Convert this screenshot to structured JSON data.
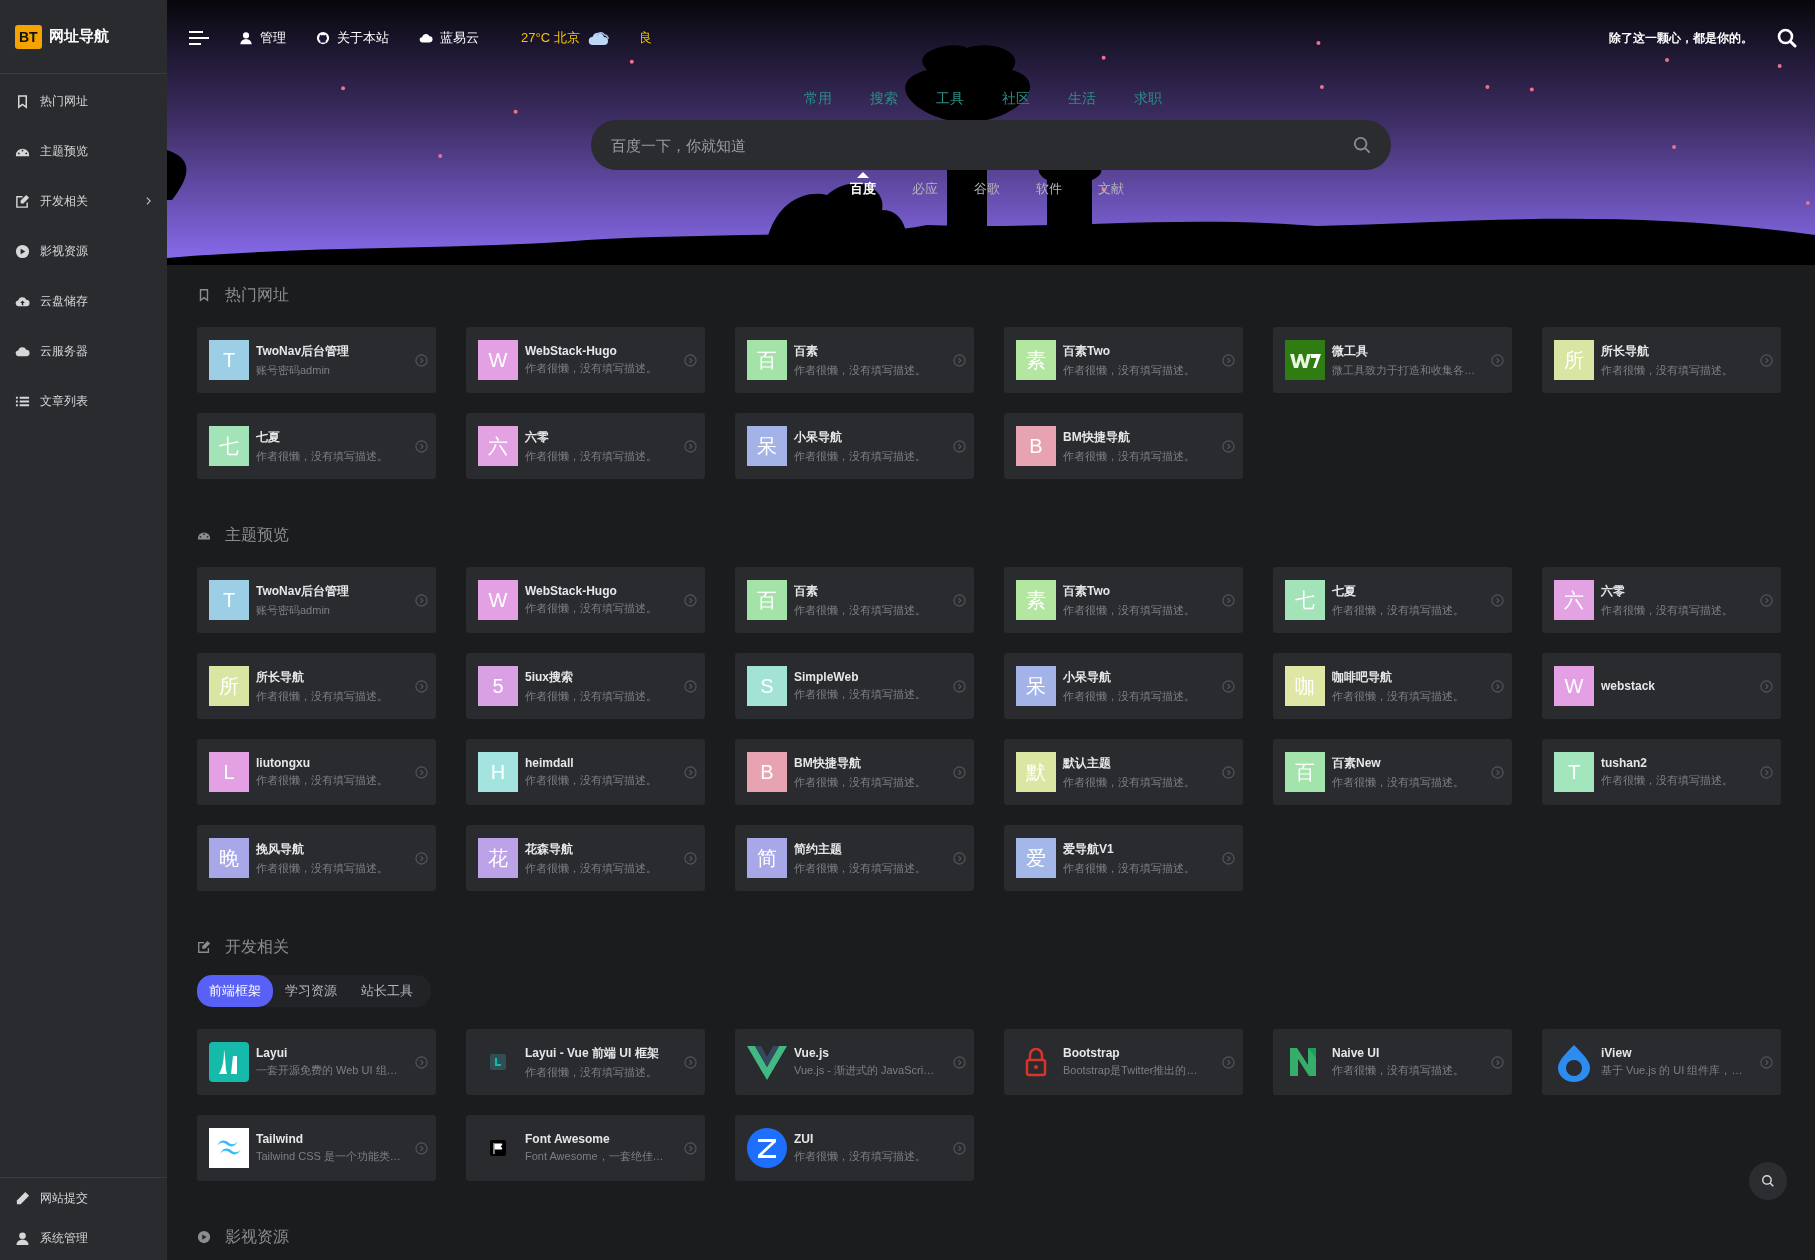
{
  "sidebar": {
    "logo_badge": "BT",
    "logo_text": "网址导航",
    "items": [
      {
        "label": "热门网址",
        "kind": "bookmark",
        "expandable": false
      },
      {
        "label": "主题预览",
        "kind": "gauge",
        "expandable": false
      },
      {
        "label": "开发相关",
        "kind": "edit",
        "expandable": true
      },
      {
        "label": "影视资源",
        "kind": "play",
        "expandable": false
      },
      {
        "label": "云盘储存",
        "kind": "upload",
        "expandable": false
      },
      {
        "label": "云服务器",
        "kind": "cloud",
        "expandable": false
      },
      {
        "label": "文章列表",
        "kind": "list",
        "expandable": false
      }
    ],
    "footer_items": [
      {
        "label": "网站提交",
        "kind": "pencil"
      },
      {
        "label": "系统管理",
        "kind": "user"
      }
    ]
  },
  "topbar": {
    "links": [
      {
        "label": "管理",
        "kind": "user"
      },
      {
        "label": "关于本站",
        "kind": "github"
      },
      {
        "label": "蓝易云",
        "kind": "cloud"
      }
    ],
    "weather": "27°C 北京",
    "air_quality": "良",
    "slogan": "除了这一颗心，都是你的。"
  },
  "search": {
    "groups": [
      "常用",
      "搜索",
      "工具",
      "社区",
      "生活",
      "求职"
    ],
    "placeholder": "百度一下，你就知道",
    "engines": [
      {
        "label": "百度",
        "selected": true
      },
      {
        "label": "必应",
        "selected": false
      },
      {
        "label": "谷歌",
        "selected": false
      },
      {
        "label": "软件",
        "selected": false
      },
      {
        "label": "文献",
        "selected": false
      }
    ]
  },
  "sections": [
    {
      "title": "热门网址",
      "kind": "bookmark",
      "cards": [
        {
          "title": "TwoNav后台管理",
          "desc": "账号密码admin",
          "kind": "letter",
          "letter": "T",
          "color": "#9ccfe6"
        },
        {
          "title": "WebStack-Hugo",
          "desc": "作者很懒，没有填写描述。",
          "kind": "letter",
          "letter": "W",
          "color": "#e3a0e3"
        },
        {
          "title": "百素",
          "desc": "作者很懒，没有填写描述。",
          "kind": "letter",
          "letter": "百",
          "color": "#a3e3a8"
        },
        {
          "title": "百素Two",
          "desc": "作者很懒，没有填写描述。",
          "kind": "letter",
          "letter": "素",
          "color": "#b3e6a0"
        },
        {
          "title": "微工具",
          "desc": "微工具致力于打造和收集各…",
          "kind": "w-logo"
        },
        {
          "title": "所长导航",
          "desc": "作者很懒，没有填写描述。",
          "kind": "letter",
          "letter": "所",
          "color": "#d9e6a3"
        },
        {
          "title": "七夏",
          "desc": "作者很懒，没有填写描述。",
          "kind": "letter",
          "letter": "七",
          "color": "#a3e3b8"
        },
        {
          "title": "六零",
          "desc": "作者很懒，没有填写描述。",
          "kind": "letter",
          "letter": "六",
          "color": "#e3a3e3"
        },
        {
          "title": "小呆导航",
          "desc": "作者很懒，没有填写描述。",
          "kind": "letter",
          "letter": "呆",
          "color": "#a3b3e8"
        },
        {
          "title": "BM快捷导航",
          "desc": "作者很懒，没有填写描述。",
          "kind": "letter",
          "letter": "B",
          "color": "#e8a3b3"
        }
      ]
    },
    {
      "title": "主题预览",
      "kind": "gauge",
      "cards": [
        {
          "title": "TwoNav后台管理",
          "desc": "账号密码admin",
          "kind": "letter",
          "letter": "T",
          "color": "#9ccfe6"
        },
        {
          "title": "WebStack-Hugo",
          "desc": "作者很懒，没有填写描述。",
          "kind": "letter",
          "letter": "W",
          "color": "#e3a0e3"
        },
        {
          "title": "百素",
          "desc": "作者很懒，没有填写描述。",
          "kind": "letter",
          "letter": "百",
          "color": "#a3e3a8"
        },
        {
          "title": "百素Two",
          "desc": "作者很懒，没有填写描述。",
          "kind": "letter",
          "letter": "素",
          "color": "#b3e6a0"
        },
        {
          "title": "七夏",
          "desc": "作者很懒，没有填写描述。",
          "kind": "letter",
          "letter": "七",
          "color": "#a3e3b8"
        },
        {
          "title": "六零",
          "desc": "作者很懒，没有填写描述。",
          "kind": "letter",
          "letter": "六",
          "color": "#e3a3e3"
        },
        {
          "title": "所长导航",
          "desc": "作者很懒，没有填写描述。",
          "kind": "letter",
          "letter": "所",
          "color": "#d9e6a3"
        },
        {
          "title": "5iux搜索",
          "desc": "作者很懒，没有填写描述。",
          "kind": "letter",
          "letter": "5",
          "color": "#d9a0e3"
        },
        {
          "title": "SimpleWeb",
          "desc": "作者很懒，没有填写描述。",
          "kind": "letter",
          "letter": "S",
          "color": "#a3e3d6"
        },
        {
          "title": "小呆导航",
          "desc": "作者很懒，没有填写描述。",
          "kind": "letter",
          "letter": "呆",
          "color": "#a3b3e8"
        },
        {
          "title": "咖啡吧导航",
          "desc": "作者很懒，没有填写描述。",
          "kind": "letter",
          "letter": "咖",
          "color": "#e0e6a3"
        },
        {
          "title": "webstack",
          "kind": "letter",
          "letter": "W",
          "color": "#e3a0e3"
        },
        {
          "title": "liutongxu",
          "desc": "作者很懒，没有填写描述。",
          "kind": "letter",
          "letter": "L",
          "color": "#e3a0e3"
        },
        {
          "title": "heimdall",
          "desc": "作者很懒，没有填写描述。",
          "kind": "letter",
          "letter": "H",
          "color": "#a3e3e0"
        },
        {
          "title": "BM快捷导航",
          "desc": "作者很懒，没有填写描述。",
          "kind": "letter",
          "letter": "B",
          "color": "#e8a3b3"
        },
        {
          "title": "默认主题",
          "desc": "作者很懒，没有填写描述。",
          "kind": "letter",
          "letter": "默",
          "color": "#dbe6a3"
        },
        {
          "title": "百素New",
          "desc": "作者很懒，没有填写描述。",
          "kind": "letter",
          "letter": "百",
          "color": "#a3e3ac"
        },
        {
          "title": "tushan2",
          "desc": "作者很懒，没有填写描述。",
          "kind": "letter",
          "letter": "T",
          "color": "#a3e6bd"
        },
        {
          "title": "挽风导航",
          "desc": "作者很懒，没有填写描述。",
          "kind": "letter",
          "letter": "晚",
          "color": "#a8a8e8"
        },
        {
          "title": "花森导航",
          "desc": "作者很懒，没有填写描述。",
          "kind": "letter",
          "letter": "花",
          "color": "#bca3e8"
        },
        {
          "title": "简约主题",
          "desc": "作者很懒，没有填写描述。",
          "kind": "letter",
          "letter": "简",
          "color": "#a8a8e8"
        },
        {
          "title": "爱导航V1",
          "desc": "作者很懒，没有填写描述。",
          "kind": "letter",
          "letter": "爱",
          "color": "#a3b8e8"
        }
      ]
    },
    {
      "title": "开发相关",
      "kind": "edit",
      "tabs": [
        {
          "label": "前端框架",
          "selected": true
        },
        {
          "label": "学习资源",
          "selected": false
        },
        {
          "label": "站长工具",
          "selected": false
        }
      ],
      "cards": [
        {
          "title": "Layui",
          "desc": "一套开源免费的 Web UI 组…",
          "kind": "l-logo"
        },
        {
          "title": "Layui - Vue 前端 UI 框架",
          "desc": "作者很懒，没有填写描述。",
          "kind": "square-logo"
        },
        {
          "title": "Vue.js",
          "desc": "Vue.js - 渐进式的 JavaScri…",
          "kind": "v-logo"
        },
        {
          "title": "Bootstrap",
          "desc": "Bootstrap是Twitter推出的…",
          "kind": "lock-logo"
        },
        {
          "title": "Naive UI",
          "desc": "作者很懒，没有填写描述。",
          "kind": "n-logo"
        },
        {
          "title": "iView",
          "desc": "基于 Vue.js 的 UI 组件库，…",
          "kind": "drop-logo"
        },
        {
          "title": "Tailwind",
          "desc": "Tailwind CSS 是一个功能类…",
          "kind": "wave-logo"
        },
        {
          "title": "Font Awesome",
          "desc": "Font Awesome，一套绝佳…",
          "kind": "flag-logo"
        },
        {
          "title": "ZUI",
          "desc": "作者很懒，没有填写描述。",
          "kind": "z-logo"
        }
      ]
    },
    {
      "title": "影视资源",
      "kind": "play"
    }
  ]
}
